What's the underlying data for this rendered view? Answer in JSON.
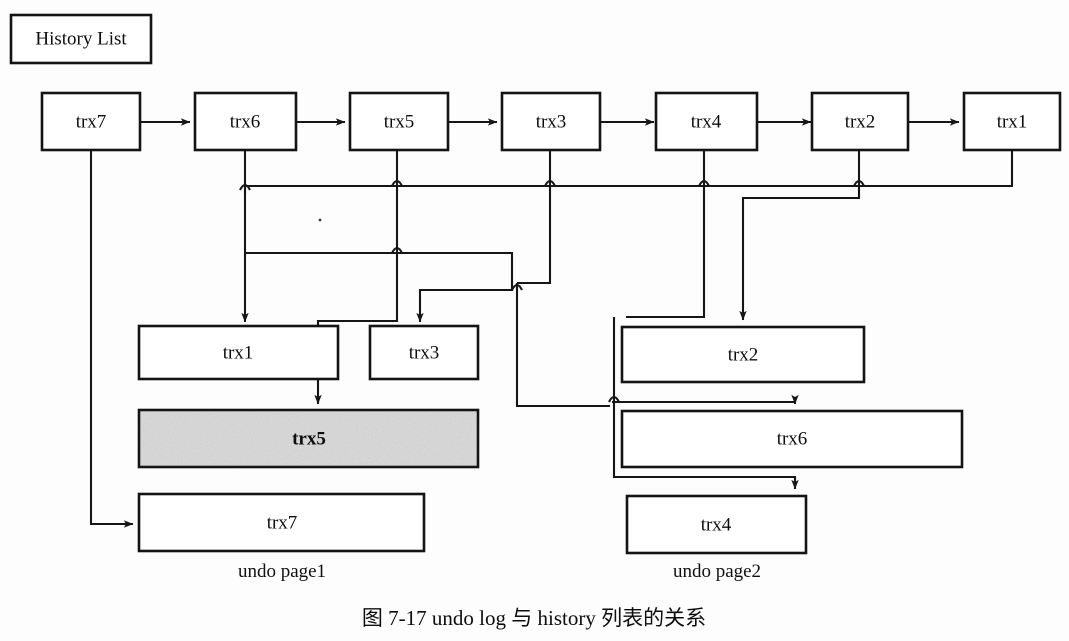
{
  "figure": {
    "title_box": {
      "label": "History List"
    },
    "caption": "图 7-17    undo log 与 history 列表的关系",
    "page_labels": {
      "page1": "undo page1",
      "page2": "undo page2"
    },
    "colors": {
      "stroke": "#161616",
      "box_fill": "#ffffff",
      "highlight_fill": "#d9d9d9",
      "background": "#fdfdfd"
    }
  },
  "history_list": {
    "label": "History List",
    "nodes": [
      {
        "id": "h-trx7",
        "label": "trx7"
      },
      {
        "id": "h-trx6",
        "label": "trx6"
      },
      {
        "id": "h-trx5",
        "label": "trx5"
      },
      {
        "id": "h-trx3",
        "label": "trx3"
      },
      {
        "id": "h-trx4",
        "label": "trx4"
      },
      {
        "id": "h-trx2",
        "label": "trx2"
      },
      {
        "id": "h-trx1",
        "label": "trx1"
      }
    ]
  },
  "undo_page1": {
    "label": "undo page1",
    "records": [
      {
        "id": "p1-trx1",
        "label": "trx1",
        "highlighted": false
      },
      {
        "id": "p1-trx3",
        "label": "trx3",
        "highlighted": false
      },
      {
        "id": "p1-trx5",
        "label": "trx5",
        "highlighted": true
      },
      {
        "id": "p1-trx7",
        "label": "trx7",
        "highlighted": false
      }
    ]
  },
  "undo_page2": {
    "label": "undo page2",
    "records": [
      {
        "id": "p2-trx2",
        "label": "trx2",
        "highlighted": false
      },
      {
        "id": "p2-trx6",
        "label": "trx6",
        "highlighted": false
      },
      {
        "id": "p2-trx4",
        "label": "trx4",
        "highlighted": false
      }
    ]
  },
  "chain_links": [
    {
      "from": "trx7",
      "to": "trx6"
    },
    {
      "from": "trx6",
      "to": "trx5"
    },
    {
      "from": "trx5",
      "to": "trx3"
    },
    {
      "from": "trx3",
      "to": "trx4"
    },
    {
      "from": "trx4",
      "to": "trx2"
    },
    {
      "from": "trx2",
      "to": "trx1"
    }
  ],
  "pointer_links": [
    {
      "from": "h-trx7",
      "to": "p1-trx7"
    },
    {
      "from": "h-trx6",
      "to": "p1-trx1"
    },
    {
      "from": "h-trx5",
      "to": "p1-trx5"
    },
    {
      "from": "h-trx3",
      "to": "p1-trx3"
    },
    {
      "from": "h-trx4",
      "to": "p2-trx2"
    },
    {
      "from": "h-trx2",
      "to": "p2-trx6"
    },
    {
      "from": "h-trx1",
      "to": "p2-trx4"
    }
  ]
}
